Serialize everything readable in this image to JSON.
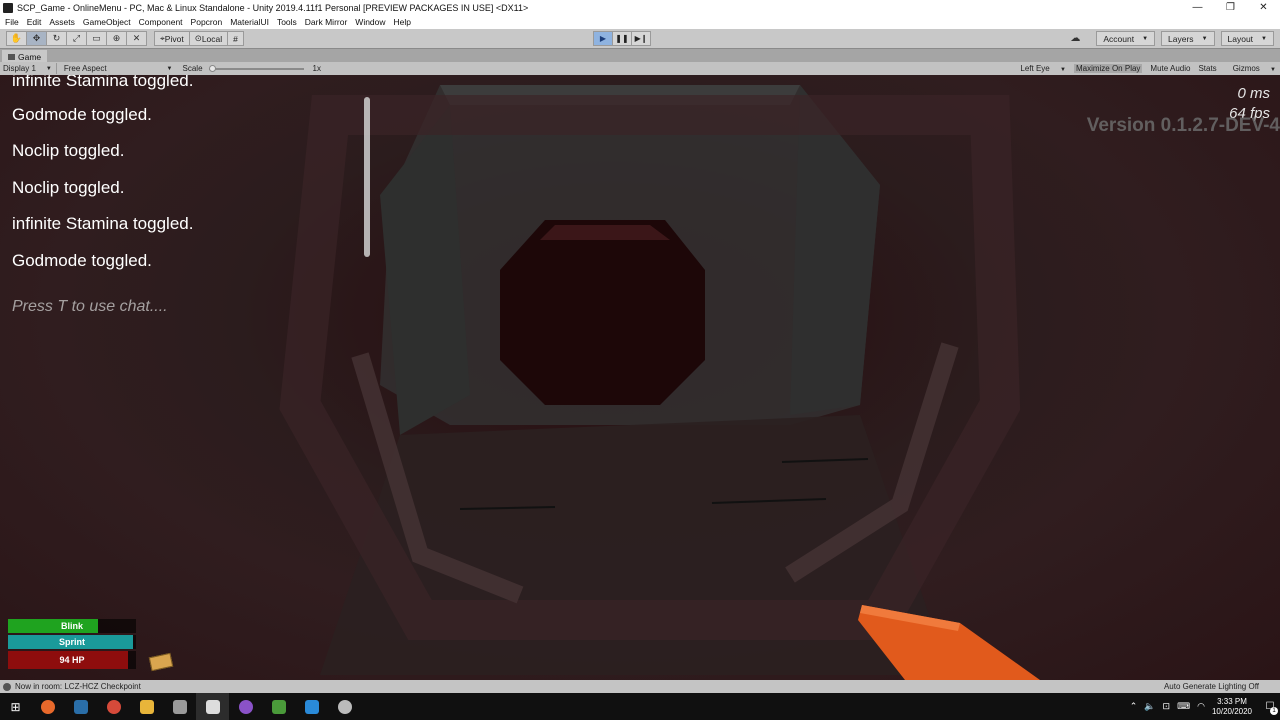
{
  "window": {
    "title": "SCP_Game - OnlineMenu - PC, Mac & Linux Standalone - Unity 2019.4.11f1 Personal [PREVIEW PACKAGES IN USE] <DX11>",
    "minimize": "—",
    "maximize": "❐",
    "close": "✕"
  },
  "menubar": {
    "items": [
      "File",
      "Edit",
      "Assets",
      "GameObject",
      "Component",
      "Popcron",
      "MaterialUI",
      "Tools",
      "Dark Mirror",
      "Window",
      "Help"
    ]
  },
  "toolbar": {
    "pivot": "Pivot",
    "local": "Local",
    "account": "Account",
    "layers": "Layers",
    "layout": "Layout"
  },
  "game_tab": {
    "label": "Game"
  },
  "game_options": {
    "display": "Display 1",
    "aspect": "Free Aspect",
    "scale_label": "Scale",
    "scale_value": "1x",
    "left_eye": "Left Eye",
    "maximize_on_play": "Maximize On Play",
    "mute_audio": "Mute Audio",
    "stats": "Stats",
    "gizmos": "Gizmos"
  },
  "game": {
    "chat": [
      "infinite Stamina toggled.",
      "Godmode toggled.",
      "Noclip toggled.",
      "Noclip toggled.",
      "infinite Stamina toggled.",
      "Godmode toggled."
    ],
    "chat_hint": "Press T to use chat....",
    "ms": "0 ms",
    "fps": "64 fps",
    "version": "Version 0.1.2.7-DEV-4",
    "hud": {
      "blink_label": "Blink",
      "blink_level": 0.7,
      "sprint_label": "Sprint",
      "sprint_level": 0.98,
      "hp_label": "94 HP",
      "hp_level": 0.94,
      "colors": {
        "blink": "#1fa31f",
        "sprint": "#1a9a9a",
        "hp": "#8e0d0d"
      }
    }
  },
  "status_bar": {
    "room": "Now in room: LCZ-HCZ Checkpoint",
    "lighting": "Auto Generate Lighting Off"
  },
  "taskbar": {
    "apps": [
      {
        "name": "firefox-icon",
        "color": "#e8692b"
      },
      {
        "name": "steam-icon",
        "color": "#2a6ea8"
      },
      {
        "name": "chrome-icon",
        "color": "#d64a3a"
      },
      {
        "name": "file-explorer-icon",
        "color": "#e8b53a"
      },
      {
        "name": "printer-icon",
        "color": "#9a9a9a"
      },
      {
        "name": "unity-icon",
        "color": "#dddddd"
      },
      {
        "name": "discord-icon",
        "color": "#8a52c8"
      },
      {
        "name": "notepad-icon",
        "color": "#4a9a3a"
      },
      {
        "name": "vscode-icon",
        "color": "#2a8ad8"
      },
      {
        "name": "unity-hub-icon",
        "color": "#bbbbbb"
      }
    ],
    "time": "3:33 PM",
    "date": "10/20/2020",
    "notifications": "1"
  }
}
